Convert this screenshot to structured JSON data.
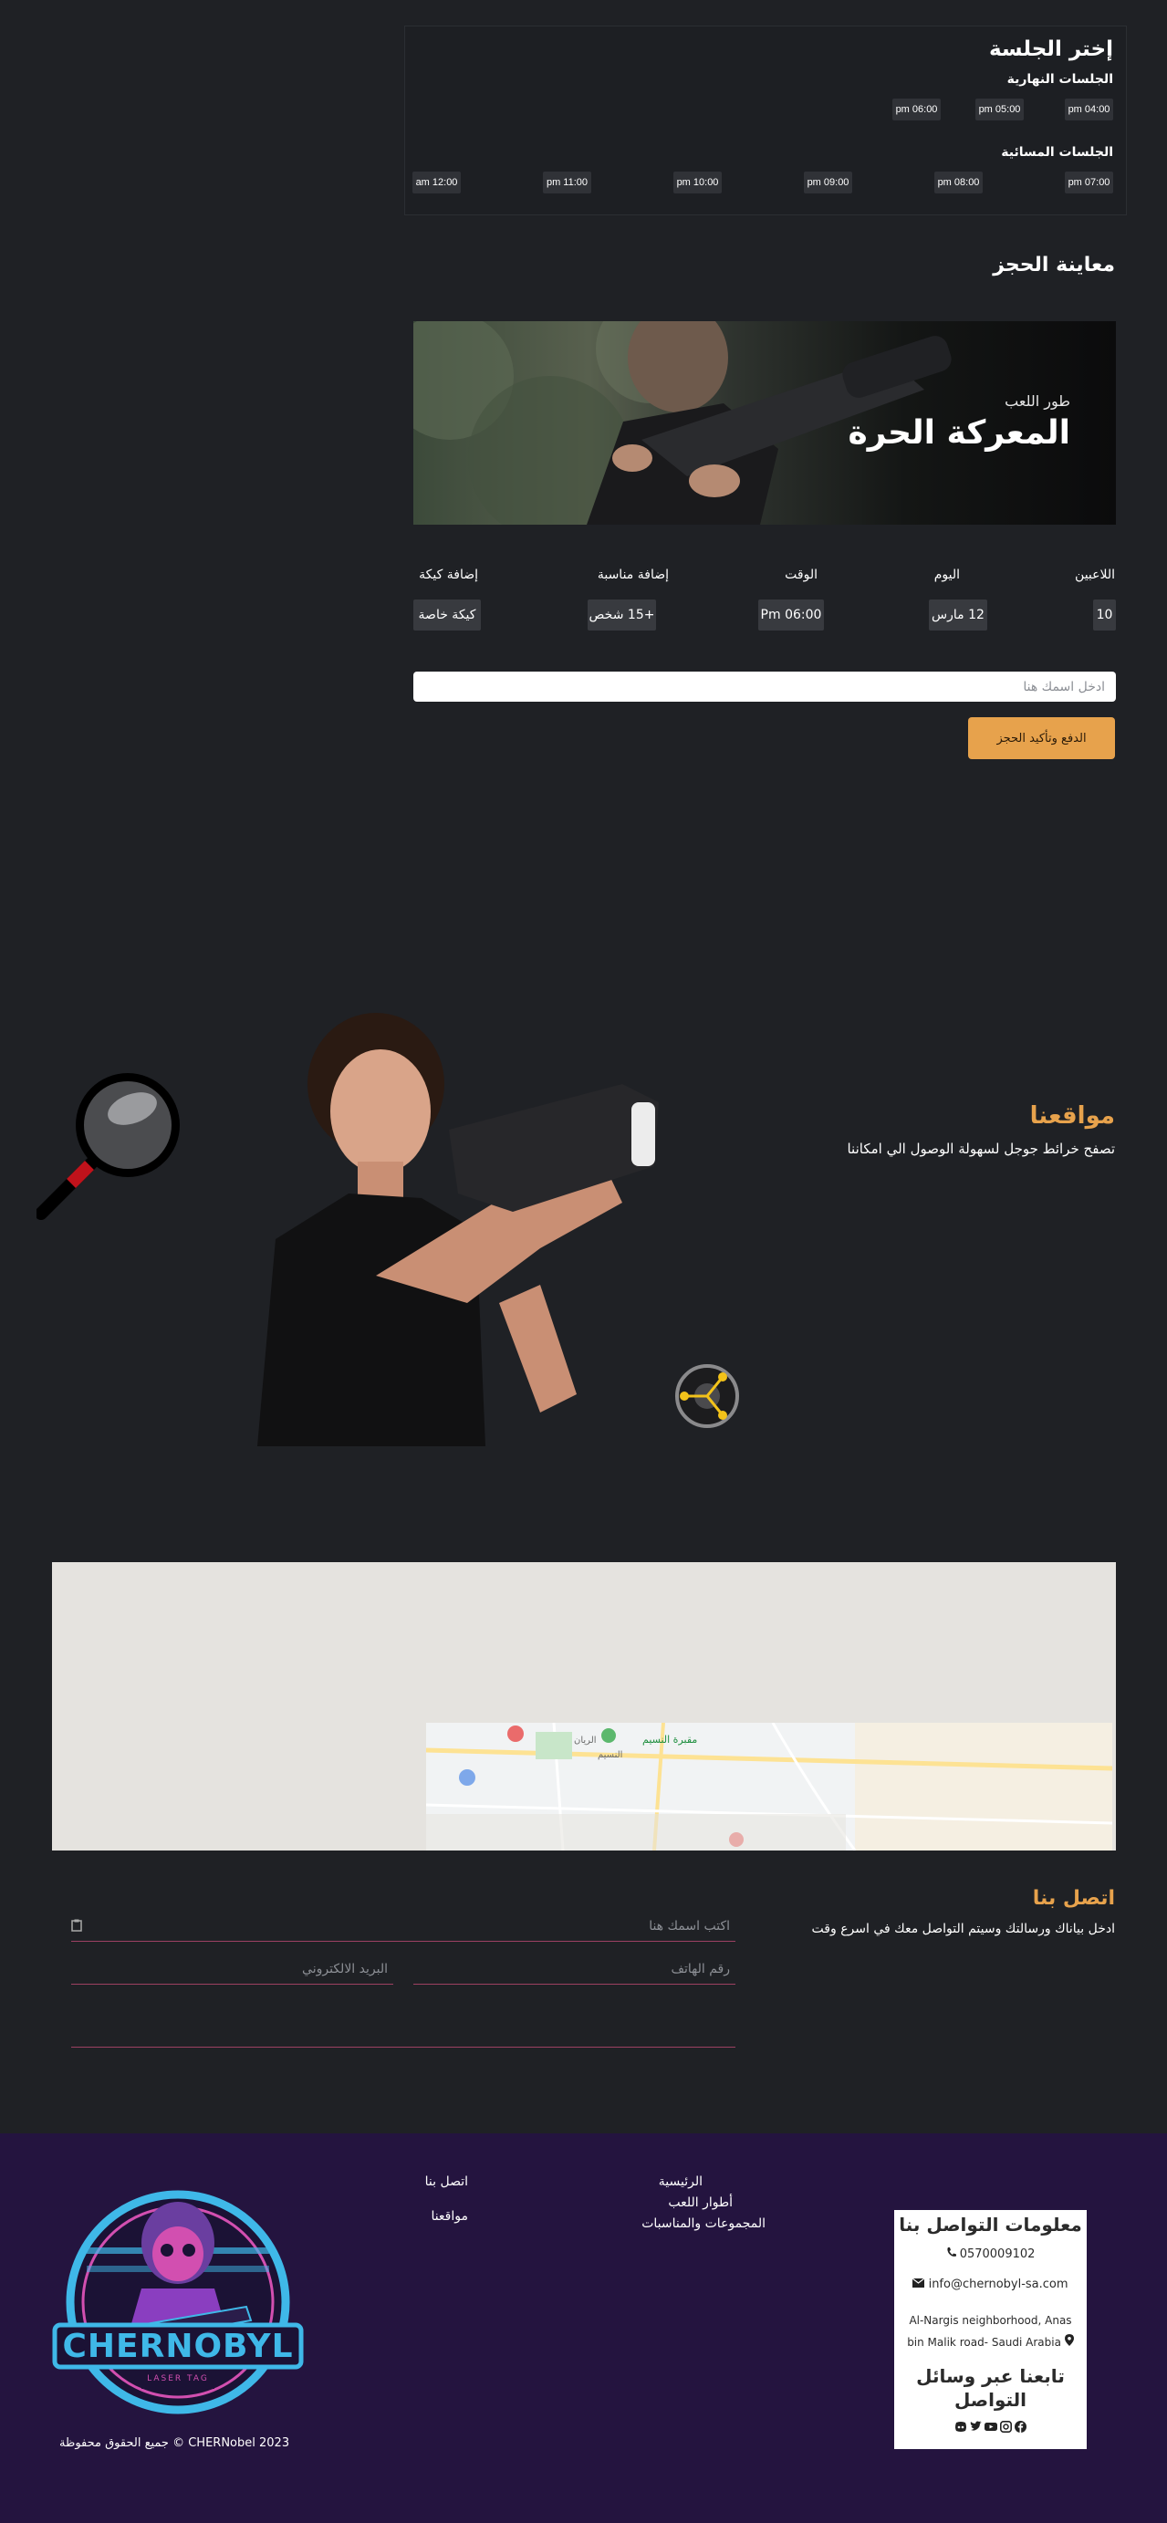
{
  "sessions": {
    "title": "إختر الجلسة",
    "day_heading": "الجلسات النهارية",
    "day_slots": [
      "pm 04:00",
      "pm 05:00",
      "pm 06:00"
    ],
    "evening_heading": "الجلسات المسائية",
    "evening_slots": [
      "pm 07:00",
      "pm 08:00",
      "pm 09:00",
      "pm 10:00",
      "pm 11:00",
      "am 12:00"
    ]
  },
  "preview": {
    "title": "معاينة الحجز",
    "banner_kicker": "طور اللعب",
    "banner_title": "المعركة الحرة",
    "labels": [
      "اللاعبين",
      "اليوم",
      "الوقت",
      "إضافة مناسبة",
      "إضافة كيكة"
    ],
    "values": [
      "10",
      "12 مارس",
      "Pm 06:00",
      "+15 شخص",
      "كيكة خاصة"
    ]
  },
  "booking": {
    "name_placeholder": "ادخل اسمك هنا",
    "pay_label": "الدفع وتأكيد الحجز"
  },
  "locations": {
    "title": "مواقعنا",
    "subtitle": "تصفح خرائط جوجل لسهولة الوصول الي امكاننا"
  },
  "map": {
    "labels": [
      "مقبرة النسيم",
      "الريان",
      "النسيم"
    ]
  },
  "contact": {
    "title": "اتصل بنا",
    "subtitle": "ادخل بياناك ورسالتك وسيتم التواصل معك في اسرع وقت",
    "name_placeholder": "اكتب اسمك هنا",
    "phone_placeholder": "رقم الهاتف",
    "email_placeholder": "البريد الالكتروني"
  },
  "footer": {
    "info_title": "معلومات التواصل بنا",
    "phone": "0570009102",
    "email": "info@chernobyl-sa.com",
    "address": "Al-Nargis neighborhood, Anas bin Malik road- Saudi Arabia",
    "follow_title": "تابعنا عبر وسائل التواصل",
    "links_col1": [
      "الرئيسية",
      "أطوار اللعب",
      "المجموعات والمناسبات"
    ],
    "links_col2": [
      "اتصل بنا",
      "مواقعنا"
    ],
    "logo_text": "CHERNOBYL",
    "logo_tagline": "LASER TAG",
    "copyright": "CHERNobel 2023 © جميع الحقوق محفوظة"
  },
  "colors": {
    "background": "#1f2125",
    "accent_orange": "#e7a24c",
    "footer_bg": "#24143f",
    "input_underline": "#9c4162",
    "logo_blue": "#3fb8e8",
    "logo_pink": "#d24fb0"
  },
  "icons": [
    "phone-icon",
    "envelope-icon",
    "map-pin-icon",
    "facebook-icon",
    "instagram-icon",
    "youtube-icon",
    "twitter-icon",
    "discord-icon",
    "magnifier-icon",
    "hub-icon",
    "clipboard-icon"
  ]
}
